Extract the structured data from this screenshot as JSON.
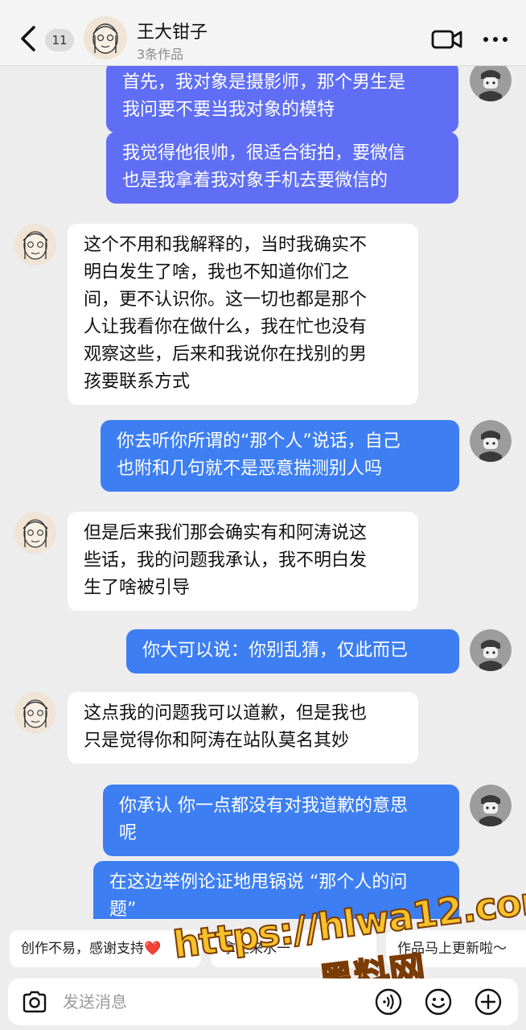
{
  "header": {
    "unread_count": "11",
    "name": "王大钳子",
    "subtitle": "3条作品"
  },
  "messages": [
    {
      "side": "out",
      "text": "首先，我对象是摄影师，那个男生是\n我问要不要当我对象的模特"
    },
    {
      "side": "out",
      "text": "我觉得他很帅，很适合街拍，要微信\n也是我拿着我对象手机去要微信的"
    },
    {
      "side": "in",
      "text": "这个不用和我解释的，当时我确实不\n明白发生了啥，我也不知道你们之\n间，更不认识你。这一切也都是那个\n人让我看你在做什么，我在忙也没有\n观察这些，后来和我说你在找别的男\n孩要联系方式"
    },
    {
      "side": "out",
      "text": "你去听你所谓的“那个人”说话，自己\n也附和几句就不是恶意揣测别人吗"
    },
    {
      "side": "in",
      "text": "但是后来我们那会确实有和阿涛说这\n些话，我的问题我承认，我不明白发\n生了啥被引导"
    },
    {
      "side": "out",
      "text": "你大可以说：你别乱猜，仅此而已"
    },
    {
      "side": "in",
      "text": "这点我的问题我可以道歉，但是我也\n只是觉得你和阿涛在站队莫名其妙"
    },
    {
      "side": "out",
      "text": "你承认 你一点都没有对我道歉的意思\n呢"
    },
    {
      "side": "out",
      "text": "在这边举例论证地甩锅说 “那个人的问\n题”"
    }
  ],
  "quick_replies": [
    {
      "label": "创作不易，感谢支持❤️"
    },
    {
      "label": "拿上来水一"
    },
    {
      "label": "作品马上更新啦～"
    }
  ],
  "input": {
    "placeholder": "发送消息"
  },
  "watermark": {
    "line1": "https://hlwa12.com",
    "line2": "黑料网"
  },
  "colors": {
    "outgoing_bubble": "#3d7ef2",
    "outgoing_bubble_alt": "#5f6ef4",
    "incoming_bubble": "#ffffff",
    "background": "#ededed"
  },
  "icons": [
    "back-arrow-icon",
    "video-call-icon",
    "more-icon",
    "camera-icon",
    "voice-icon",
    "emoji-icon",
    "plus-icon"
  ]
}
